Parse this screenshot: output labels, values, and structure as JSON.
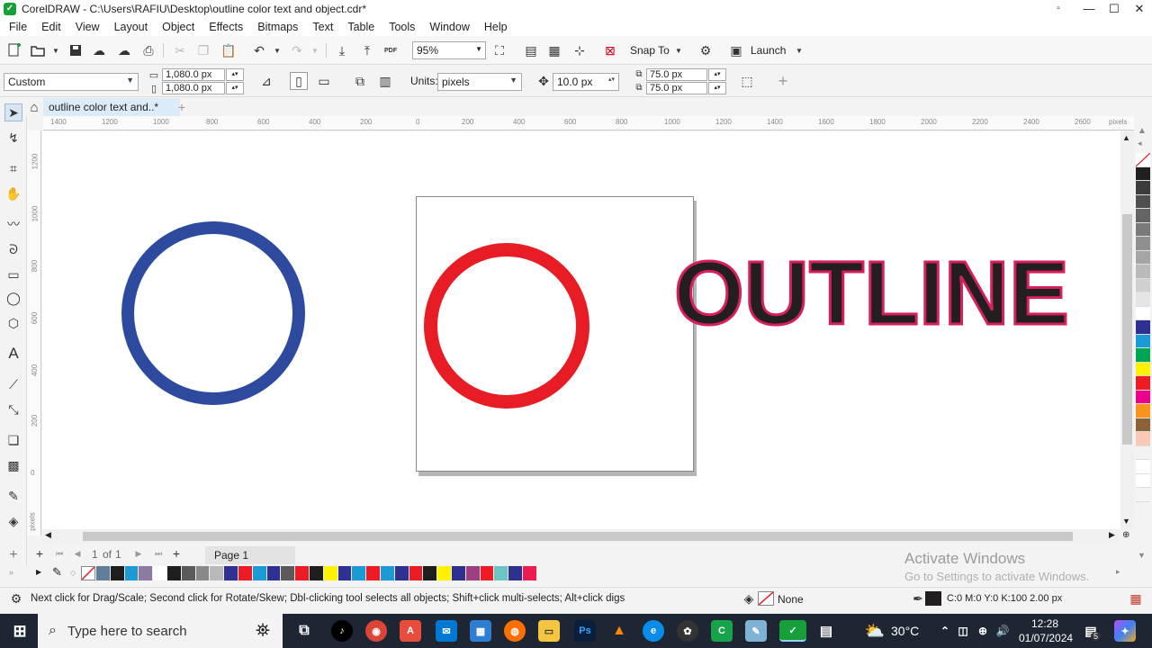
{
  "window": {
    "title": "CorelDRAW - C:\\Users\\RAFIU\\Desktop\\outline color text and object.cdr*",
    "minimize": "—",
    "maximize": "☐",
    "close": "✕",
    "restore_small": "▫"
  },
  "menu": [
    "File",
    "Edit",
    "View",
    "Layout",
    "Object",
    "Effects",
    "Bitmaps",
    "Text",
    "Table",
    "Tools",
    "Window",
    "Help"
  ],
  "toolbar": {
    "zoom": "95%",
    "snap_to": "Snap To",
    "launch": "Launch",
    "pdf": "PDF"
  },
  "propertybar": {
    "page_preset": "Custom",
    "width": "1,080.0 px",
    "height": "1,080.0 px",
    "units_label": "Units:",
    "units_value": "pixels",
    "nudge": "10.0 px",
    "dup_x": "75.0 px",
    "dup_y": "75.0 px"
  },
  "document_tab": "outline color text and..*",
  "ruler": {
    "h_ticks": [
      "1400",
      "1200",
      "1000",
      "800",
      "600",
      "400",
      "200",
      "0",
      "200",
      "400",
      "600",
      "800",
      "1000",
      "1200",
      "1400",
      "1600",
      "1800",
      "2000",
      "2200",
      "2400",
      "2600"
    ],
    "h_units": "pixels",
    "v_ticks": [
      "1200",
      "1000",
      "800",
      "600",
      "400",
      "200",
      "0"
    ],
    "v_units": "pixels"
  },
  "canvas_text": "OUTLINE",
  "page_nav": {
    "current": "1",
    "of": "of",
    "total": "1",
    "page_tab": "Page 1"
  },
  "palette_right": [
    "#ffffff",
    "#231f20",
    "#3c3c3c",
    "#4f4f4f",
    "#646464",
    "#7a7a7a",
    "#8f8f8f",
    "#a5a5a5",
    "#bababa",
    "#d0d0d0",
    "#e5e5e5",
    "#ffffff",
    "#2e3192",
    "#1b9ad6",
    "#00a651",
    "#fff200",
    "#ed1c24",
    "#ec008c",
    "#f7941d",
    "#8c6239",
    "#f9c9b6",
    "#f2f2f2",
    "#ffffff",
    "#ffffff",
    "#f4f4f4"
  ],
  "palette_bottom": [
    "#607d9a",
    "#1e1e1e",
    "#1b9ad6",
    "#8c7aa3",
    "#ffffff",
    "#1e1e1e",
    "#5a5a5a",
    "#898989",
    "#b9b9b9",
    "#2e3192",
    "#ed1c24",
    "#1b9ad6",
    "#2e3192",
    "#5a5a5a",
    "#ed1c24",
    "#1e1e1e",
    "#fff200",
    "#2e3192",
    "#1b9ad6",
    "#ed1c24",
    "#1b9ad6",
    "#2e3192",
    "#ed1c24",
    "#1e1e1e",
    "#fff200",
    "#2e3192",
    "#9e3f7f",
    "#ed1c24",
    "#6ec3c4",
    "#2e3192",
    "#ed1c50"
  ],
  "watermark": {
    "line1": "Activate Windows",
    "line2": "Go to Settings to activate Windows."
  },
  "status": {
    "hint": "Next click for Drag/Scale; Second click for Rotate/Skew; Dbl-clicking tool selects all objects; Shift+click multi-selects; Alt+click digs",
    "fill": "None",
    "outline": "C:0 M:0 Y:0 K:100  2.00 px"
  },
  "taskbar": {
    "search_placeholder": "Type here to search",
    "temperature": "30°C",
    "time": "12:28",
    "date": "01/07/2024",
    "notif_count": "5"
  },
  "colors": {
    "blue_circle": "#2e4a9e",
    "red_circle": "#e81c24",
    "text_fill": "#231f20",
    "text_outline": "#d61f5b"
  }
}
